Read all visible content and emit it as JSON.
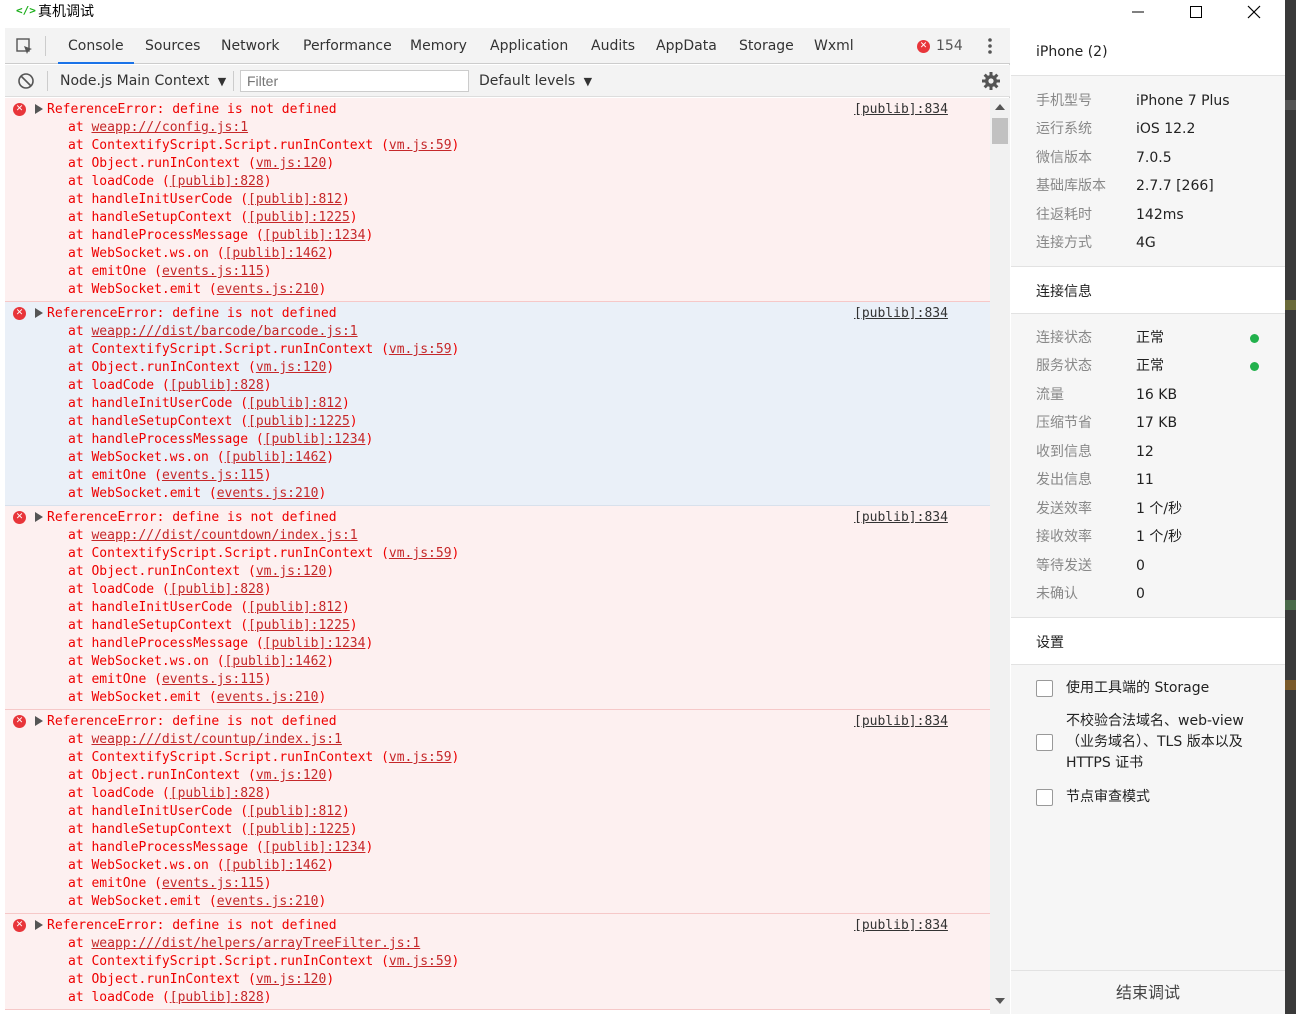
{
  "window": {
    "title": "真机调试",
    "app_icon": "<‎/>"
  },
  "toolbar": {
    "tabs": [
      "Console",
      "Sources",
      "Network",
      "Performance",
      "Memory",
      "Application",
      "Audits",
      "AppData",
      "Storage",
      "Wxml"
    ],
    "active_tab": "Console",
    "error_count": "154"
  },
  "filterbar": {
    "context": "Node.js Main Context",
    "filter_placeholder": "Filter",
    "levels": "Default levels"
  },
  "console": {
    "entries": [
      {
        "message": "ReferenceError: define is not defined",
        "source": "[publib]:834",
        "frames": [
          {
            "fn": "",
            "loc": "weapp:///config.js:1"
          },
          {
            "fn": "ContextifyScript.Script.runInContext",
            "loc": "vm.js:59"
          },
          {
            "fn": "Object.runInContext",
            "loc": "vm.js:120"
          },
          {
            "fn": "loadCode",
            "loc": "[publib]:828"
          },
          {
            "fn": "handleInitUserCode",
            "loc": "[publib]:812"
          },
          {
            "fn": "handleSetupContext",
            "loc": "[publib]:1225"
          },
          {
            "fn": "handleProcessMessage",
            "loc": "[publib]:1234"
          },
          {
            "fn": "WebSocket.ws.on",
            "loc": "[publib]:1462"
          },
          {
            "fn": "emitOne",
            "loc": "events.js:115"
          },
          {
            "fn": "WebSocket.emit",
            "loc": "events.js:210"
          }
        ]
      },
      {
        "message": "ReferenceError: define is not defined",
        "source": "[publib]:834",
        "highlight": true,
        "frames": [
          {
            "fn": "",
            "loc": "weapp:///dist/barcode/barcode.js:1"
          },
          {
            "fn": "ContextifyScript.Script.runInContext",
            "loc": "vm.js:59"
          },
          {
            "fn": "Object.runInContext",
            "loc": "vm.js:120"
          },
          {
            "fn": "loadCode",
            "loc": "[publib]:828"
          },
          {
            "fn": "handleInitUserCode",
            "loc": "[publib]:812"
          },
          {
            "fn": "handleSetupContext",
            "loc": "[publib]:1225"
          },
          {
            "fn": "handleProcessMessage",
            "loc": "[publib]:1234"
          },
          {
            "fn": "WebSocket.ws.on",
            "loc": "[publib]:1462"
          },
          {
            "fn": "emitOne",
            "loc": "events.js:115"
          },
          {
            "fn": "WebSocket.emit",
            "loc": "events.js:210"
          }
        ]
      },
      {
        "message": "ReferenceError: define is not defined",
        "source": "[publib]:834",
        "frames": [
          {
            "fn": "",
            "loc": "weapp:///dist/countdown/index.js:1"
          },
          {
            "fn": "ContextifyScript.Script.runInContext",
            "loc": "vm.js:59"
          },
          {
            "fn": "Object.runInContext",
            "loc": "vm.js:120"
          },
          {
            "fn": "loadCode",
            "loc": "[publib]:828"
          },
          {
            "fn": "handleInitUserCode",
            "loc": "[publib]:812"
          },
          {
            "fn": "handleSetupContext",
            "loc": "[publib]:1225"
          },
          {
            "fn": "handleProcessMessage",
            "loc": "[publib]:1234"
          },
          {
            "fn": "WebSocket.ws.on",
            "loc": "[publib]:1462"
          },
          {
            "fn": "emitOne",
            "loc": "events.js:115"
          },
          {
            "fn": "WebSocket.emit",
            "loc": "events.js:210"
          }
        ]
      },
      {
        "message": "ReferenceError: define is not defined",
        "source": "[publib]:834",
        "frames": [
          {
            "fn": "",
            "loc": "weapp:///dist/countup/index.js:1"
          },
          {
            "fn": "ContextifyScript.Script.runInContext",
            "loc": "vm.js:59"
          },
          {
            "fn": "Object.runInContext",
            "loc": "vm.js:120"
          },
          {
            "fn": "loadCode",
            "loc": "[publib]:828"
          },
          {
            "fn": "handleInitUserCode",
            "loc": "[publib]:812"
          },
          {
            "fn": "handleSetupContext",
            "loc": "[publib]:1225"
          },
          {
            "fn": "handleProcessMessage",
            "loc": "[publib]:1234"
          },
          {
            "fn": "WebSocket.ws.on",
            "loc": "[publib]:1462"
          },
          {
            "fn": "emitOne",
            "loc": "events.js:115"
          },
          {
            "fn": "WebSocket.emit",
            "loc": "events.js:210"
          }
        ]
      },
      {
        "message": "ReferenceError: define is not defined",
        "source": "[publib]:834",
        "frames": [
          {
            "fn": "",
            "loc": "weapp:///dist/helpers/arrayTreeFilter.js:1"
          },
          {
            "fn": "ContextifyScript.Script.runInContext",
            "loc": "vm.js:59"
          },
          {
            "fn": "Object.runInContext",
            "loc": "vm.js:120"
          },
          {
            "fn": "loadCode",
            "loc": "[publib]:828"
          }
        ]
      }
    ]
  },
  "panel": {
    "device_title": "iPhone (2)",
    "device_info": [
      {
        "k": "手机型号",
        "v": "iPhone 7 Plus"
      },
      {
        "k": "运行系统",
        "v": "iOS 12.2"
      },
      {
        "k": "微信版本",
        "v": "7.0.5"
      },
      {
        "k": "基础库版本",
        "v": "2.7.7 [266]"
      },
      {
        "k": "往返耗时",
        "v": "142ms"
      },
      {
        "k": "连接方式",
        "v": "4G"
      }
    ],
    "conn_title": "连接信息",
    "conn_info": [
      {
        "k": "连接状态",
        "v": "正常",
        "ok": true
      },
      {
        "k": "服务状态",
        "v": "正常",
        "ok": true
      },
      {
        "k": "流量",
        "v": "16 KB"
      },
      {
        "k": "压缩节省",
        "v": "17 KB"
      },
      {
        "k": "收到信息",
        "v": "12"
      },
      {
        "k": "发出信息",
        "v": "11"
      },
      {
        "k": "发送效率",
        "v": "1 个/秒"
      },
      {
        "k": "接收效率",
        "v": "1 个/秒"
      },
      {
        "k": "等待发送",
        "v": "0"
      },
      {
        "k": "未确认",
        "v": "0"
      }
    ],
    "settings_title": "设置",
    "settings": [
      {
        "label": "使用工具端的 Storage",
        "checked": false
      },
      {
        "label": "不校验合法域名、web-view（业务域名）、TLS 版本以及 HTTPS 证书",
        "checked": false
      },
      {
        "label": "节点审查模式",
        "checked": false
      }
    ],
    "end_button": "结束调试"
  },
  "colors": {
    "error": "#e8353a",
    "error_text": "#ee0000",
    "entry_bg": "#fdf0f0",
    "entry_highlight_bg": "#eaf0f8",
    "status_ok": "#22b14c",
    "tab_active_underline": "#1a73e8"
  },
  "icons": {
    "inspect": "inspect-element-icon",
    "clear": "clear-console-icon",
    "settings": "gear-icon",
    "menu": "kebab-menu-icon",
    "error": "error-circle-icon",
    "expand": "expand-triangle-icon"
  }
}
